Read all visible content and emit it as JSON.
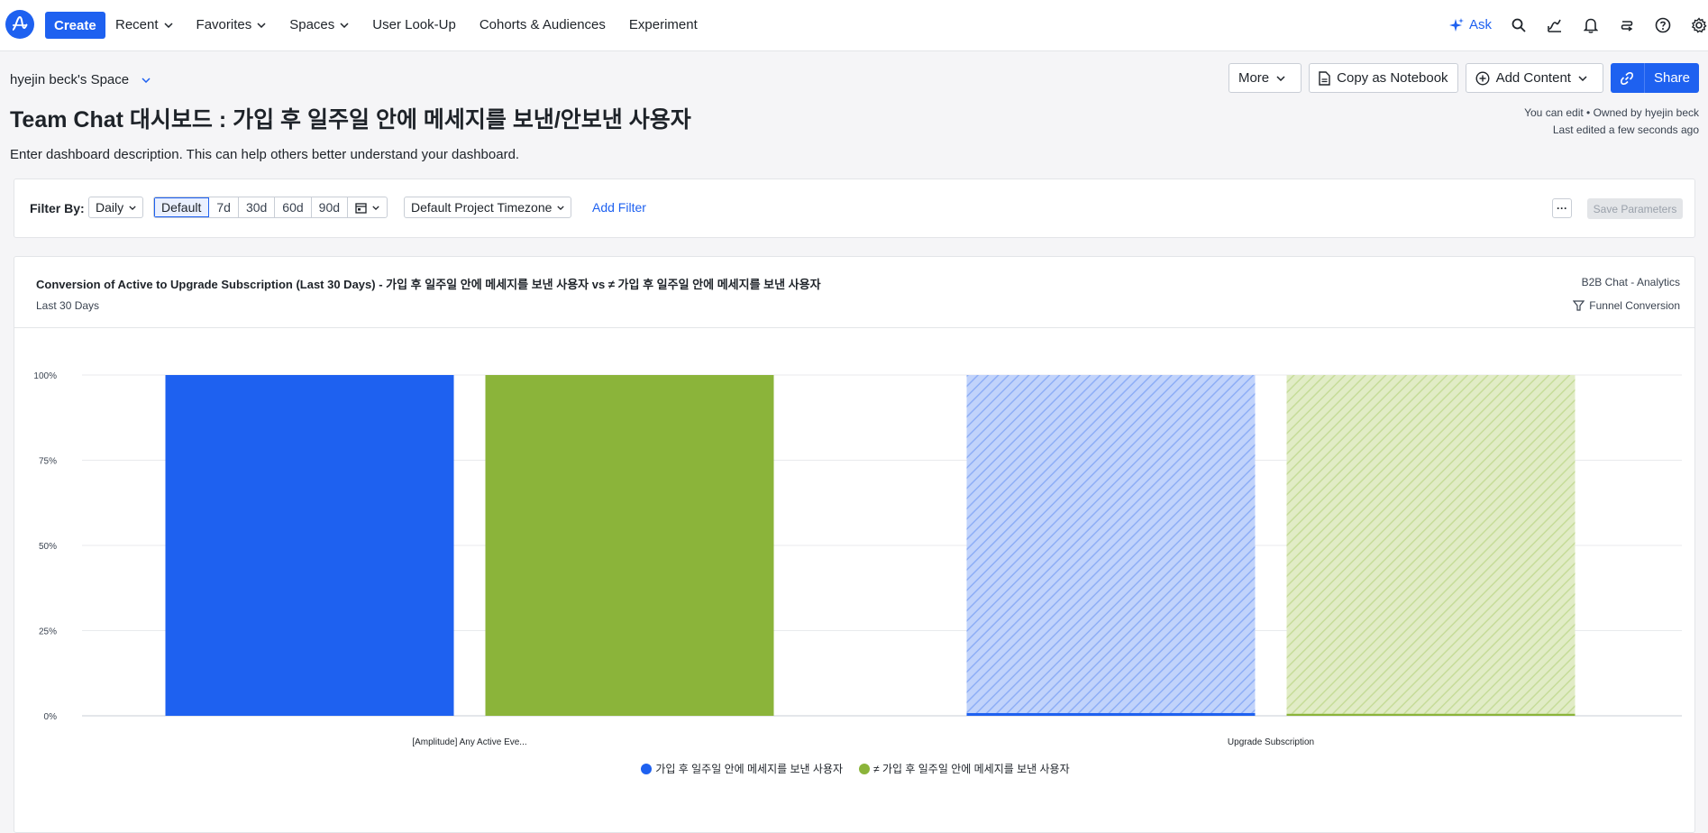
{
  "nav": {
    "create": "Create",
    "items": [
      {
        "label": "Recent",
        "chevron": true
      },
      {
        "label": "Favorites",
        "chevron": true
      },
      {
        "label": "Spaces",
        "chevron": true
      },
      {
        "label": "User Look-Up",
        "chevron": false
      },
      {
        "label": "Cohorts & Audiences",
        "chevron": false
      },
      {
        "label": "Experiment",
        "chevron": false
      }
    ],
    "ask": "Ask",
    "right_icons": [
      "search-icon",
      "trend-icon",
      "bell-icon",
      "switch-icon",
      "help-icon",
      "gear-icon"
    ]
  },
  "header": {
    "space": "hyejin beck's Space",
    "title": "Team Chat 대시보드 : 가입 후 일주일 안에 메세지를 보낸/안보낸 사용자",
    "description": "Enter dashboard description. This can help others better understand your dashboard.",
    "more": "More",
    "copy_notebook": "Copy as Notebook",
    "add_content": "Add Content",
    "share": "Share",
    "owner_line": "You can edit • Owned by hyejin beck",
    "edited_line": "Last edited a few seconds ago"
  },
  "filter": {
    "label": "Filter By:",
    "interval": "Daily",
    "ranges": [
      "Default",
      "7d",
      "30d",
      "60d",
      "90d"
    ],
    "active_range": "Default",
    "timezone": "Default Project Timezone",
    "add_filter": "Add Filter",
    "more": "···",
    "save": "Save Parameters"
  },
  "card": {
    "title": "Conversion of Active to Upgrade Subscription (Last 30 Days) - 가입 후 일주일 안에 메세지를 보낸 사용자 vs ≠ 가입 후 일주일 안에 메세지를 보낸 사용자",
    "subtitle": "Last 30 Days",
    "project": "B2B Chat - Analytics",
    "type": "Funnel Conversion"
  },
  "colors": {
    "accent": "#1e61f0",
    "series1": "#1e61f0",
    "series2": "#8bb43a",
    "series1_light": "#c1d3fb",
    "series2_light": "#e1ecc6"
  },
  "chart_data": {
    "type": "bar",
    "categories": [
      "[Amplitude] Any Active Eve...",
      "Upgrade Subscription"
    ],
    "series": [
      {
        "name": "가입 후 일주일 안에 메세지를 보낸 사용자",
        "values": [
          100,
          0.8
        ]
      },
      {
        "name": "≠ 가입 후 일주일 안에 메세지를 보낸 사용자",
        "values": [
          100,
          0.6
        ]
      }
    ],
    "dropoff_hatched": true,
    "y_ticks": [
      "0%",
      "25%",
      "50%",
      "75%",
      "100%"
    ],
    "ylim": [
      0,
      100
    ],
    "grid": true,
    "legend": "bottom-center"
  }
}
